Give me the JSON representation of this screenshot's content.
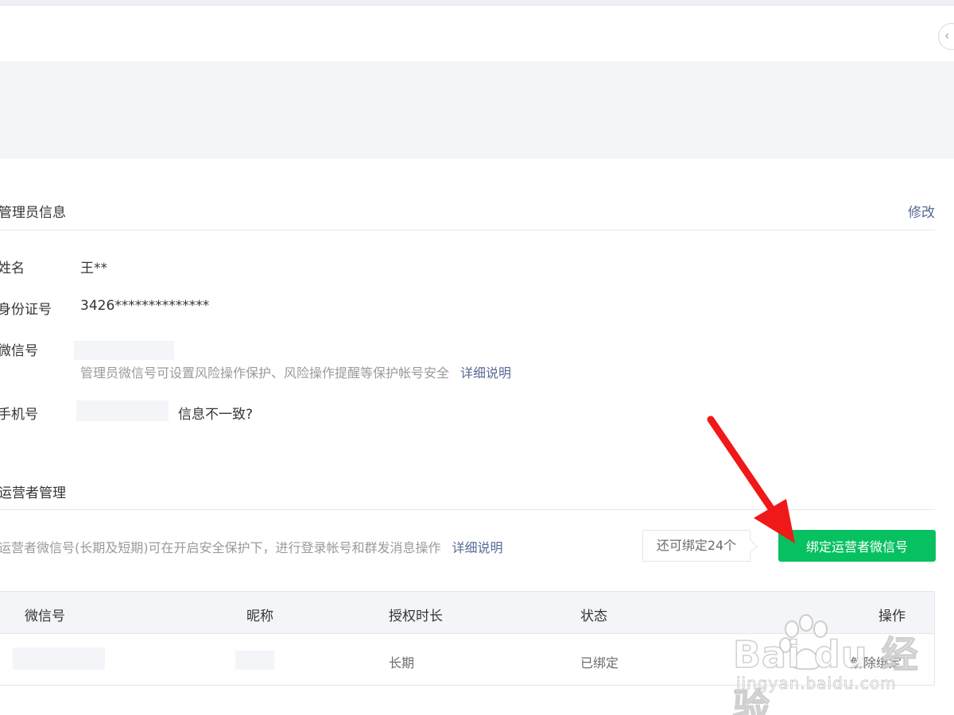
{
  "admin": {
    "title": "管理员信息",
    "edit_label": "修改",
    "name_label": "姓名",
    "name_value": "王**",
    "id_label": "身份证号",
    "id_value": "3426**************",
    "wechat_label": "微信号",
    "wechat_hint": "管理员微信号可设置风险操作保护、风险操作提醒等保护帐号安全",
    "wechat_detail_link": "详细说明",
    "phone_label": "手机号",
    "phone_mismatch_link": "信息不一致?"
  },
  "operators": {
    "title": "运营者管理",
    "hint": "运营者微信号(长期及短期)可在开启安全保护下，进行登录帐号和群发消息操作",
    "detail_link": "详细说明",
    "quota_label": "还可绑定24个",
    "bind_button": "绑定运营者微信号",
    "table": {
      "headers": [
        "微信号",
        "昵称",
        "授权时长",
        "状态",
        "操作"
      ],
      "rows": [
        {
          "wechat": "",
          "nickname": "",
          "duration": "长期",
          "status": "已绑定",
          "action": "解除绑定"
        }
      ]
    }
  },
  "watermark": {
    "logo": "Bai du 经验",
    "url": "jingyan.baidu.com"
  },
  "colors": {
    "accent_green": "#07c160",
    "link_blue": "#576b95",
    "annotation_red": "#f01818"
  },
  "icons": {
    "collapse": "chevron-left-icon",
    "annotation": "red-arrow-icon"
  }
}
